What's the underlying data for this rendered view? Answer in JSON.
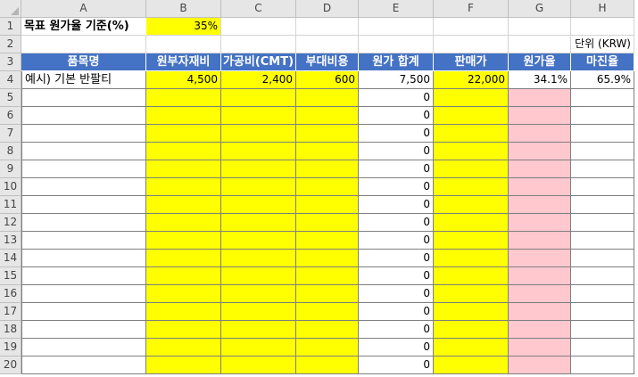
{
  "columns": [
    "A",
    "B",
    "C",
    "D",
    "E",
    "F",
    "G",
    "H"
  ],
  "rows": [
    "1",
    "2",
    "3",
    "4",
    "5",
    "6",
    "7",
    "8",
    "9",
    "10",
    "11",
    "12",
    "13",
    "14",
    "15",
    "16",
    "17",
    "18",
    "19",
    "20"
  ],
  "row1": {
    "title": "목표 원가율 기준(%)",
    "target_rate": "35%"
  },
  "row2": {
    "unit": "단위 (KRW)"
  },
  "headers": [
    "품목명",
    "원부자재비",
    "가공비(CMT)",
    "부대비용",
    "원가 합계",
    "판매가",
    "원가율",
    "마진율"
  ],
  "example": {
    "name": "예시) 기본 반팔티",
    "material": "4,500",
    "cmt": "2,400",
    "extra": "600",
    "total": "7,500",
    "price": "22,000",
    "cost_rate": "34.1%",
    "margin": "65.9%"
  },
  "empty_total": "0",
  "colors": {
    "header_bg": "#4472c4",
    "input_fill": "#ffff00",
    "rate_fill": "#ffc7ce"
  }
}
